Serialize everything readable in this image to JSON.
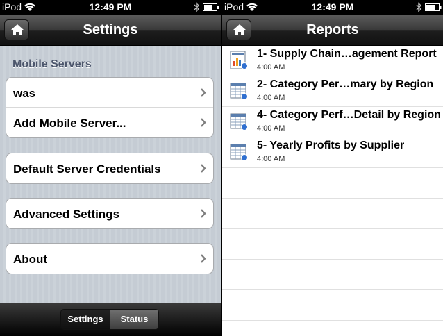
{
  "left": {
    "status_bar": {
      "carrier": "iPod",
      "time": "12:49 PM"
    },
    "nav": {
      "title": "Settings",
      "home_icon": "home-icon"
    },
    "section_header": "Mobile Servers",
    "servers": [
      {
        "label": "was"
      },
      {
        "label": "Add Mobile Server..."
      }
    ],
    "credentials": {
      "label": "Default Server Credentials"
    },
    "advanced": {
      "label": "Advanced Settings"
    },
    "about": {
      "label": "About"
    },
    "tabs": [
      {
        "label": "Settings",
        "selected": true
      },
      {
        "label": "Status",
        "selected": false
      }
    ]
  },
  "right": {
    "status_bar": {
      "carrier": "iPod",
      "time": "12:49 PM"
    },
    "nav": {
      "title": "Reports",
      "home_icon": "home-icon"
    },
    "reports": [
      {
        "title": "1- Supply Chain…agement Report",
        "time": "4:00 AM",
        "icon": "chart-report-icon"
      },
      {
        "title": "2- Category Per…mary by Region",
        "time": "4:00 AM",
        "icon": "grid-report-icon"
      },
      {
        "title": "4- Category Perf…Detail by Region",
        "time": "4:00 AM",
        "icon": "grid-report-icon"
      },
      {
        "title": "5- Yearly Profits by Supplier",
        "time": "4:00 AM",
        "icon": "grid-report-icon"
      }
    ]
  },
  "colors": {
    "section_header": "#4c566c",
    "settings_bg": "#c5ccd4",
    "nav_bar": "#2b2b2b"
  }
}
